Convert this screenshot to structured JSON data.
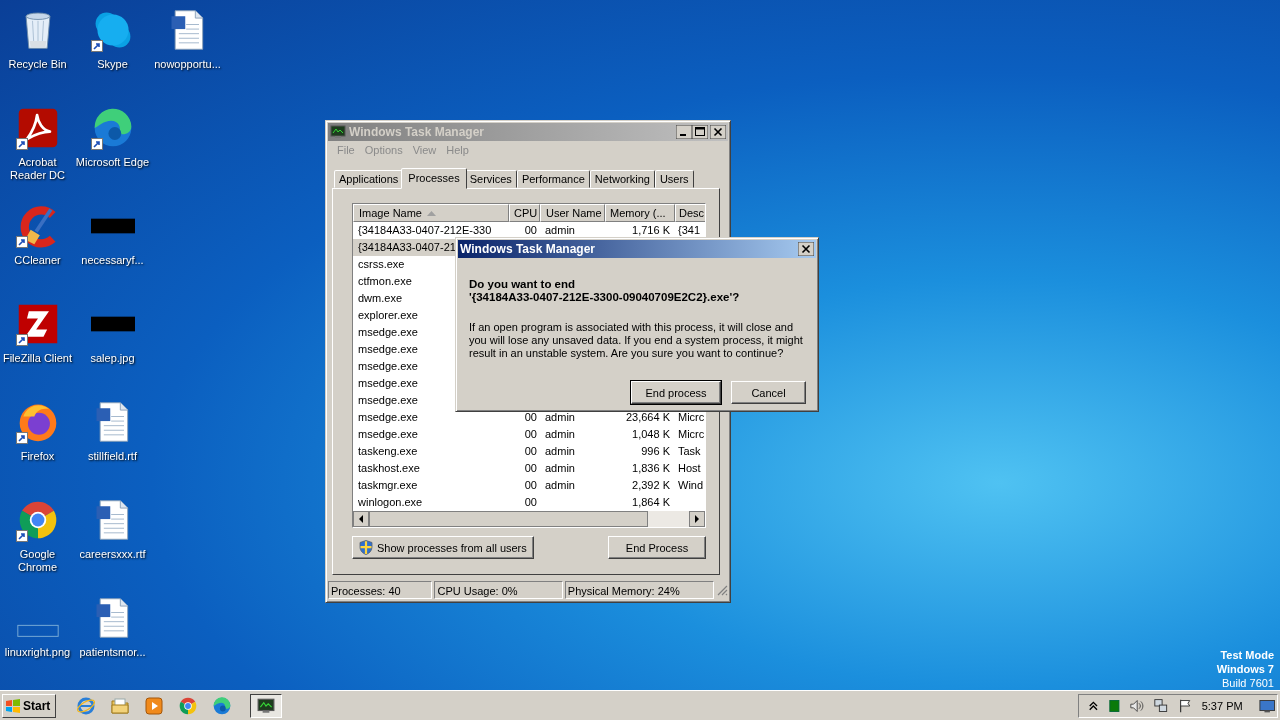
{
  "desktop": {
    "icons": [
      {
        "label": "Recycle Bin",
        "kind": "recycle-bin",
        "shortcut": false
      },
      {
        "label": "Acrobat\nReader DC",
        "kind": "acrobat",
        "shortcut": true
      },
      {
        "label": "CCleaner",
        "kind": "ccleaner",
        "shortcut": true
      },
      {
        "label": "FileZilla Client",
        "kind": "filezilla",
        "shortcut": true
      },
      {
        "label": "Firefox",
        "kind": "firefox",
        "shortcut": true
      },
      {
        "label": "Google\nChrome",
        "kind": "chrome",
        "shortcut": true
      },
      {
        "label": "linuxright.png",
        "kind": "image-blank",
        "shortcut": false
      },
      {
        "label": "Skype",
        "kind": "skype",
        "shortcut": true
      },
      {
        "label": "Microsoft Edge",
        "kind": "edge",
        "shortcut": true
      },
      {
        "label": "necessaryf...",
        "kind": "image-dark",
        "shortcut": false
      },
      {
        "label": "salep.jpg",
        "kind": "image-dark",
        "shortcut": false
      },
      {
        "label": "stillfield.rtf",
        "kind": "doc",
        "shortcut": false
      },
      {
        "label": "careersxxx.rtf",
        "kind": "doc",
        "shortcut": false
      },
      {
        "label": "patientsmor...",
        "kind": "doc",
        "shortcut": false
      },
      {
        "label": "nowopportu...",
        "kind": "doc",
        "shortcut": false
      }
    ],
    "os_notice": [
      {
        "text": "Test Mode",
        "bold": true
      },
      {
        "text": "Windows 7",
        "bold": true
      },
      {
        "text": "Build 7601",
        "bold": false
      }
    ]
  },
  "task_manager": {
    "title": "Windows Task Manager",
    "active": false,
    "menu": [
      {
        "label": "File",
        "disabled": true
      },
      {
        "label": "Options",
        "disabled": true
      },
      {
        "label": "View",
        "disabled": true
      },
      {
        "label": "Help",
        "disabled": true
      }
    ],
    "tabs": [
      {
        "label": "Applications",
        "selected": false
      },
      {
        "label": "Processes",
        "selected": true
      },
      {
        "label": "Services",
        "selected": false
      },
      {
        "label": "Performance",
        "selected": false
      },
      {
        "label": "Networking",
        "selected": false
      },
      {
        "label": "Users",
        "selected": false
      }
    ],
    "table": {
      "columns": [
        {
          "label": "Image Name",
          "sorted": true
        },
        {
          "label": "CPU",
          "sorted": false
        },
        {
          "label": "User Name",
          "sorted": false
        },
        {
          "label": "Memory (...",
          "sorted": false
        },
        {
          "label": "Desc",
          "sorted": false
        }
      ],
      "rows": [
        {
          "image_name": "{34184A33-0407-212E-330",
          "cpu": "00",
          "user_name": "admin",
          "memory": "1,716 K",
          "description": "{341",
          "selected": false
        },
        {
          "image_name": "{34184A33-0407-21",
          "selected": true
        },
        {
          "image_name": "csrss.exe",
          "selected": false
        },
        {
          "image_name": "ctfmon.exe",
          "selected": false
        },
        {
          "image_name": "dwm.exe",
          "selected": false
        },
        {
          "image_name": "explorer.exe",
          "selected": false
        },
        {
          "image_name": "msedge.exe",
          "selected": false
        },
        {
          "image_name": "msedge.exe",
          "selected": false
        },
        {
          "image_name": "msedge.exe",
          "selected": false
        },
        {
          "image_name": "msedge.exe",
          "selected": false
        },
        {
          "image_name": "msedge.exe",
          "selected": false
        },
        {
          "image_name": "msedge.exe",
          "cpu": "00",
          "user_name": "admin",
          "memory": "23,664 K",
          "description": "Micrc",
          "selected": false
        },
        {
          "image_name": "msedge.exe",
          "cpu": "00",
          "user_name": "admin",
          "memory": "1,048 K",
          "description": "Micrc",
          "selected": false
        },
        {
          "image_name": "taskeng.exe",
          "cpu": "00",
          "user_name": "admin",
          "memory": "996 K",
          "description": "Task",
          "selected": false
        },
        {
          "image_name": "taskhost.exe",
          "cpu": "00",
          "user_name": "admin",
          "memory": "1,836 K",
          "description": "Host",
          "selected": false
        },
        {
          "image_name": "taskmgr.exe",
          "cpu": "00",
          "user_name": "admin",
          "memory": "2,392 K",
          "description": "Wind",
          "selected": false
        },
        {
          "image_name": "winlogon.exe",
          "cpu": "00",
          "memory": "1,864 K",
          "selected": false
        }
      ]
    },
    "show_all_button": "Show processes from all users",
    "end_process_button": "End Process",
    "status_bar": [
      "Processes: 40",
      "CPU Usage: 0%",
      "Physical Memory: 24%"
    ]
  },
  "dialog": {
    "title": "Windows Task Manager",
    "active": true,
    "question": [
      "Do you want to end",
      "'{34184A33-0407-212E-3300-09040709E2C2}.exe'?"
    ],
    "message": "If an open program is associated with this process, it will close and you will lose any unsaved data. If you end a system process, it might result in an unstable system. Are you sure you want to continue?",
    "buttons": [
      {
        "label": "End process",
        "default": true
      },
      {
        "label": "Cancel",
        "default": false
      }
    ]
  },
  "taskbar": {
    "start": "Start",
    "pinned": [
      {
        "kind": "ie"
      },
      {
        "kind": "folder"
      },
      {
        "kind": "media"
      },
      {
        "kind": "chrome"
      },
      {
        "kind": "edge"
      }
    ],
    "tasks": [
      {
        "kind": "task-manager",
        "selected": true
      }
    ],
    "tray": [
      {
        "kind": "chevron"
      },
      {
        "kind": "green-square"
      },
      {
        "kind": "speaker"
      },
      {
        "kind": "network"
      },
      {
        "kind": "flag"
      }
    ],
    "time": "5:37 PM"
  }
}
